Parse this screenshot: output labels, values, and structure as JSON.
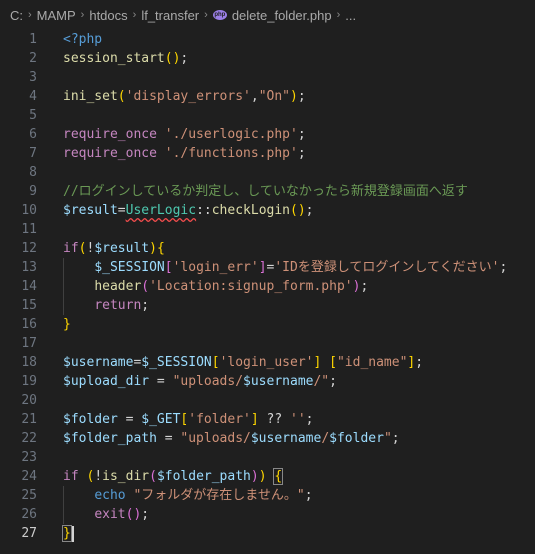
{
  "breadcrumb": {
    "items": [
      "C:",
      "MAMP",
      "htdocs",
      "lf_transfer"
    ],
    "file": "delete_folder.php",
    "file_icon": "php-icon",
    "php_glyph": "php",
    "more": "...",
    "separator": "›"
  },
  "code_lines": [
    {
      "n": "1",
      "t": [
        [
          "<?php",
          "k"
        ]
      ]
    },
    {
      "n": "2",
      "t": [
        [
          "session_start",
          "f"
        ],
        [
          "()",
          "b1"
        ],
        [
          ";",
          "p"
        ]
      ]
    },
    {
      "n": "3",
      "t": []
    },
    {
      "n": "4",
      "t": [
        [
          "ini_set",
          "f"
        ],
        [
          "(",
          "b1"
        ],
        [
          "'display_errors'",
          "s"
        ],
        [
          ",",
          "p"
        ],
        [
          "\"On\"",
          "s"
        ],
        [
          ")",
          "b1"
        ],
        [
          ";",
          "p"
        ]
      ]
    },
    {
      "n": "5",
      "t": []
    },
    {
      "n": "6",
      "t": [
        [
          "require_once ",
          "ctl"
        ],
        [
          "'./userlogic.php'",
          "s"
        ],
        [
          ";",
          "p"
        ]
      ]
    },
    {
      "n": "7",
      "t": [
        [
          "require_once ",
          "ctl"
        ],
        [
          "'./functions.php'",
          "s"
        ],
        [
          ";",
          "p"
        ]
      ]
    },
    {
      "n": "8",
      "t": []
    },
    {
      "n": "9",
      "t": [
        [
          "//ログインしているか判定し、していなかったら新規登録画面へ返す",
          "c"
        ]
      ]
    },
    {
      "n": "10",
      "t": [
        [
          "$result",
          "v"
        ],
        [
          "=",
          "p"
        ],
        [
          "UserLogic",
          "cl squig"
        ],
        [
          "::",
          "p"
        ],
        [
          "checkLogin",
          "f"
        ],
        [
          "()",
          "b1"
        ],
        [
          ";",
          "p"
        ]
      ]
    },
    {
      "n": "11",
      "t": []
    },
    {
      "n": "12",
      "t": [
        [
          "if",
          "ctl"
        ],
        [
          "(",
          "b1"
        ],
        [
          "!",
          "p"
        ],
        [
          "$result",
          "v"
        ],
        [
          ")",
          "b1"
        ],
        [
          "{",
          "b1"
        ]
      ]
    },
    {
      "n": "13",
      "t": [
        [
          "    ",
          "p"
        ],
        [
          "$_SESSION",
          "v"
        ],
        [
          "[",
          "b2"
        ],
        [
          "'login_err'",
          "s"
        ],
        [
          "]",
          "b2"
        ],
        [
          "=",
          "p"
        ],
        [
          "'IDを登録してログインしてください'",
          "s"
        ],
        [
          ";",
          "p"
        ]
      ],
      "g": 1
    },
    {
      "n": "14",
      "t": [
        [
          "    ",
          "p"
        ],
        [
          "header",
          "f"
        ],
        [
          "(",
          "b2"
        ],
        [
          "'Location:signup_form.php'",
          "s"
        ],
        [
          ")",
          "b2"
        ],
        [
          ";",
          "p"
        ]
      ],
      "g": 1
    },
    {
      "n": "15",
      "t": [
        [
          "    ",
          "p"
        ],
        [
          "return",
          "ctl"
        ],
        [
          ";",
          "p"
        ]
      ],
      "g": 1
    },
    {
      "n": "16",
      "t": [
        [
          "}",
          "b1"
        ]
      ]
    },
    {
      "n": "17",
      "t": []
    },
    {
      "n": "18",
      "t": [
        [
          "$username",
          "v"
        ],
        [
          "=",
          "p"
        ],
        [
          "$_SESSION",
          "v"
        ],
        [
          "[",
          "b1"
        ],
        [
          "'login_user'",
          "s"
        ],
        [
          "]",
          "b1"
        ],
        [
          " ",
          "p"
        ],
        [
          "[",
          "b1"
        ],
        [
          "\"id_name\"",
          "s"
        ],
        [
          "]",
          "b1"
        ],
        [
          ";",
          "p"
        ]
      ]
    },
    {
      "n": "19",
      "t": [
        [
          "$upload_dir",
          "v"
        ],
        [
          " = ",
          "p"
        ],
        [
          "\"uploads/",
          "s"
        ],
        [
          "$username",
          "v"
        ],
        [
          "/\"",
          "s"
        ],
        [
          ";",
          "p"
        ]
      ]
    },
    {
      "n": "20",
      "t": []
    },
    {
      "n": "21",
      "t": [
        [
          "$folder",
          "v"
        ],
        [
          " = ",
          "p"
        ],
        [
          "$_GET",
          "v"
        ],
        [
          "[",
          "b1"
        ],
        [
          "'folder'",
          "s"
        ],
        [
          "]",
          "b1"
        ],
        [
          " ?? ",
          "p"
        ],
        [
          "''",
          "s"
        ],
        [
          ";",
          "p"
        ]
      ]
    },
    {
      "n": "22",
      "t": [
        [
          "$folder_path",
          "v"
        ],
        [
          " = ",
          "p"
        ],
        [
          "\"uploads/",
          "s"
        ],
        [
          "$username",
          "v"
        ],
        [
          "/",
          "s"
        ],
        [
          "$folder",
          "v"
        ],
        [
          "\"",
          "s"
        ],
        [
          ";",
          "p"
        ]
      ]
    },
    {
      "n": "23",
      "t": []
    },
    {
      "n": "24",
      "t": [
        [
          "if",
          "ctl"
        ],
        [
          " ",
          "p"
        ],
        [
          "(",
          "b1"
        ],
        [
          "!",
          "p"
        ],
        [
          "is_dir",
          "f"
        ],
        [
          "(",
          "b2"
        ],
        [
          "$folder_path",
          "v"
        ],
        [
          ")",
          "b2"
        ],
        [
          ")",
          "b1"
        ],
        [
          " ",
          "p"
        ],
        [
          "{",
          "b1 boxed"
        ]
      ]
    },
    {
      "n": "25",
      "t": [
        [
          "    ",
          "p"
        ],
        [
          "echo",
          "k"
        ],
        [
          " ",
          "p"
        ],
        [
          "\"フォルダが存在しません。\"",
          "s"
        ],
        [
          ";",
          "p"
        ]
      ],
      "g": 1
    },
    {
      "n": "26",
      "t": [
        [
          "    ",
          "p"
        ],
        [
          "exit",
          "ctl"
        ],
        [
          "()",
          "b2"
        ],
        [
          ";",
          "p"
        ]
      ],
      "g": 1
    },
    {
      "n": "27",
      "t": [
        [
          "}",
          "b1 boxed"
        ]
      ],
      "active": true,
      "cursor": true
    }
  ]
}
